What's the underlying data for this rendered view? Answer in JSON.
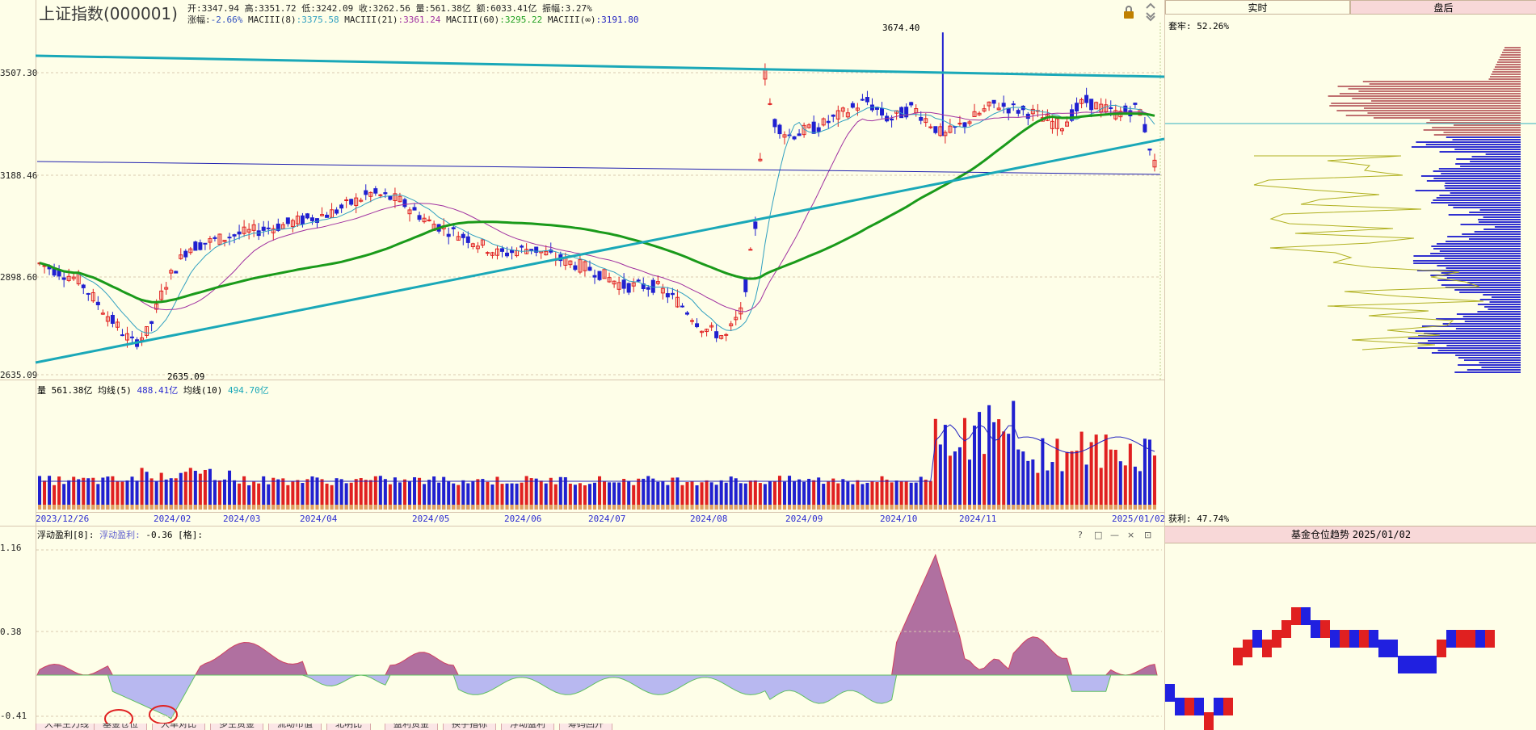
{
  "header": {
    "title": "上证指数(000001)",
    "line1": [
      {
        "label": "开:",
        "value": "3347.94"
      },
      {
        "label": "高:",
        "value": "3351.72"
      },
      {
        "label": "低:",
        "value": "3242.09"
      },
      {
        "label": "收:",
        "value": "3262.56"
      },
      {
        "label": "量:",
        "value": "561.38亿"
      },
      {
        "label": "额:",
        "value": "6033.41亿"
      },
      {
        "label": "振幅:",
        "value": "3.27%"
      }
    ],
    "line2": [
      {
        "label": "涨幅:",
        "value": "-2.66%",
        "color": "#3050c0"
      },
      {
        "label": "MACIII(8)",
        "value": ":3375.58",
        "color": "#30a0c0"
      },
      {
        "label": "MACIII(21)",
        "value": ":3361.24",
        "color": "#a030a0"
      },
      {
        "label": "MACIII(60)",
        "value": ":3295.22",
        "color": "#20a020"
      },
      {
        "label": "MACIII(∞)",
        "value": ":3191.80",
        "color": "#2020c0"
      }
    ]
  },
  "price_axis": {
    "labels": [
      "3507.30",
      "3188.46",
      "2898.60",
      "2635.09"
    ]
  },
  "price_annotations": {
    "high": "3674.40",
    "low": "2635.09"
  },
  "volume": {
    "label": "量",
    "value": "561.38亿",
    "ma5_label": "均线(5)",
    "ma5_value": "488.41亿",
    "ma10_label": "均线(10)",
    "ma10_value": "494.70亿"
  },
  "date_axis": [
    "2023/12/26",
    "2024/02",
    "2024/03",
    "2024/04",
    "2024/05",
    "2024/06",
    "2024/07",
    "2024/08",
    "2024/09",
    "2024/10",
    "2024/11",
    "2025/01/02"
  ],
  "indicator": {
    "title": "浮动盈利[8]:",
    "series_label": "浮动盈利",
    "value": "-0.36",
    "unit": "[格]:",
    "axis_labels": [
      "1.16",
      "0.38",
      "-0.41"
    ],
    "icons": [
      "?",
      "□",
      "—",
      "×",
      "⊡"
    ]
  },
  "bottom_tabs": [
    "大单主力线",
    "基金仓位",
    "大单对比",
    "多空资金",
    "流动市值",
    "北明比",
    "盈利资金",
    "换手指标",
    "浮动盈利",
    "筹码回升"
  ],
  "right_panel": {
    "tabs": [
      "实时",
      "盘后"
    ],
    "active_tab": "盘后",
    "trapped_label": "套牢:",
    "trapped_value": "52.26%",
    "profit_label": "获利:",
    "profit_value": "47.74%",
    "fund_title": "基金仓位趋势",
    "fund_date": "2025/01/02"
  },
  "toolbar": {
    "lock_icon": "lock-icon",
    "scroll_icon": "double-chevron-icon"
  },
  "colors": {
    "background": "#fefee8",
    "up": "#e02020",
    "down": "#2020d0",
    "ma8": "#30a0c0",
    "ma21": "#a030a0",
    "ma60": "#1a9a1a",
    "trend": "#1aa8b8",
    "profit_fill": "#b070a0",
    "loss_fill": "#b8b8f0"
  }
}
